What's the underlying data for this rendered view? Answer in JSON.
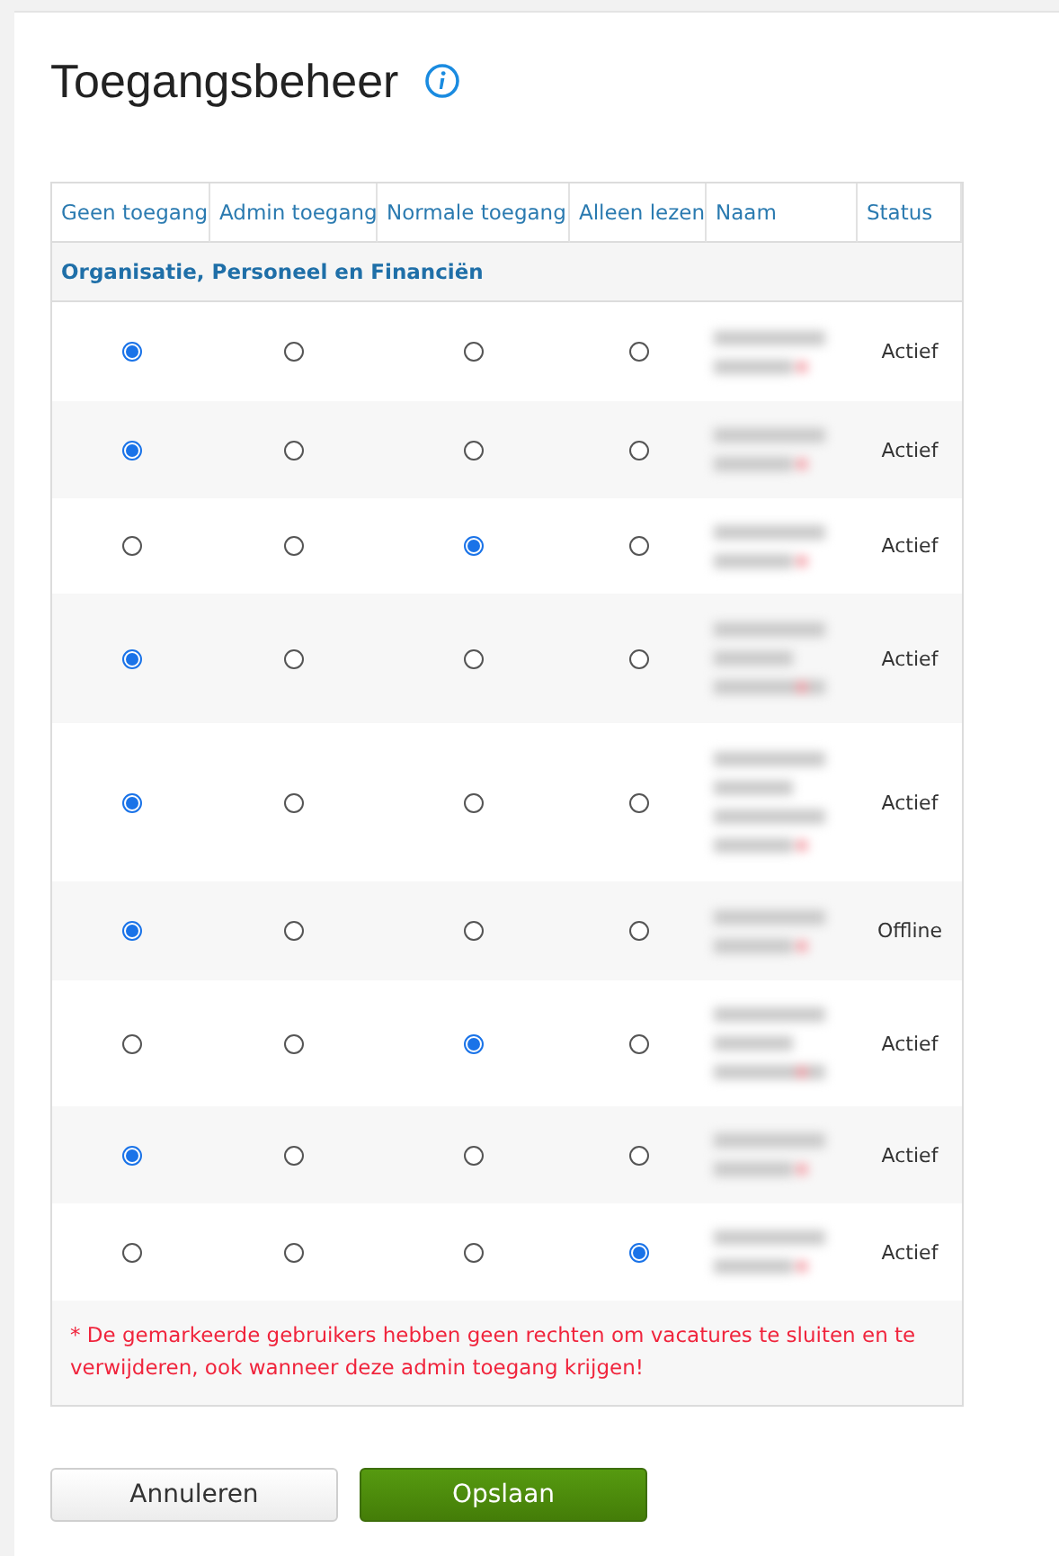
{
  "title": "Toegangsbeheer",
  "columns": [
    "Geen toegang",
    "Admin toegang",
    "Normale toegang",
    "Alleen lezen",
    "Naam",
    "Status"
  ],
  "section": "Organisatie, Personeel en Financiën",
  "rows": [
    {
      "access": [
        {
          "selected": true
        },
        {
          "selected": false
        },
        {
          "selected": false
        },
        {
          "selected": false
        }
      ],
      "status": "Actief"
    },
    {
      "access": [
        {
          "selected": true
        },
        {
          "selected": false
        },
        {
          "selected": false
        },
        {
          "selected": false
        }
      ],
      "status": "Actief"
    },
    {
      "access": [
        {
          "selected": false
        },
        {
          "selected": false
        },
        {
          "selected": true
        },
        {
          "selected": false
        }
      ],
      "status": "Actief"
    },
    {
      "access": [
        {
          "selected": true
        },
        {
          "selected": false
        },
        {
          "selected": false
        },
        {
          "selected": false
        }
      ],
      "status": "Actief"
    },
    {
      "access": [
        {
          "selected": true
        },
        {
          "selected": false
        },
        {
          "selected": false
        },
        {
          "selected": false
        }
      ],
      "status": "Actief"
    },
    {
      "access": [
        {
          "selected": true
        },
        {
          "selected": false
        },
        {
          "selected": false
        },
        {
          "selected": false
        }
      ],
      "status": "Offline"
    },
    {
      "access": [
        {
          "selected": false
        },
        {
          "selected": false
        },
        {
          "selected": true
        },
        {
          "selected": false
        }
      ],
      "status": "Actief"
    },
    {
      "access": [
        {
          "selected": true
        },
        {
          "selected": false
        },
        {
          "selected": false
        },
        {
          "selected": false
        }
      ],
      "status": "Actief"
    },
    {
      "access": [
        {
          "selected": false
        },
        {
          "selected": false
        },
        {
          "selected": false
        },
        {
          "selected": true
        }
      ],
      "status": "Actief"
    }
  ],
  "footnote": "* De gemarkeerde gebruikers hebben geen rechten om vacatures te sluiten en te verwijderen, ook wanneer deze admin toegang krijgen!",
  "buttons": [
    {
      "label": "Annuleren",
      "kind": "secondary"
    },
    {
      "label": "Opslaan",
      "kind": "primary"
    }
  ]
}
